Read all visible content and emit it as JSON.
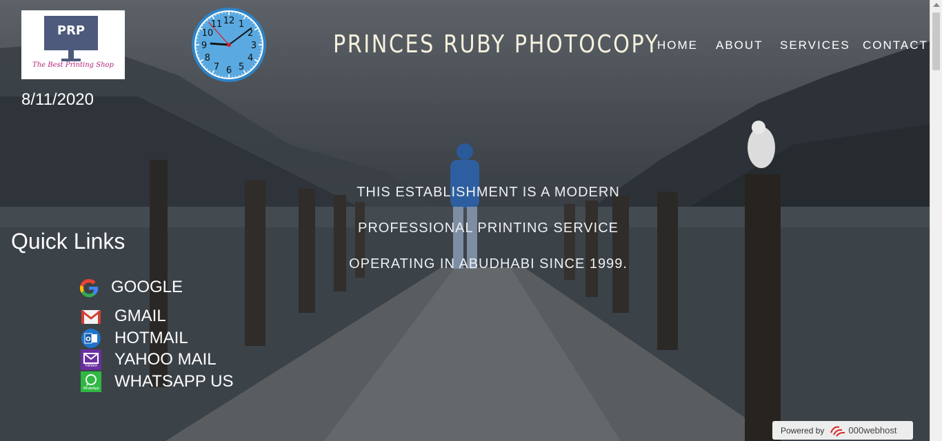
{
  "logo": {
    "text": "PRP",
    "tagline": "The Best Printing Shop"
  },
  "date": "8/11/2020",
  "clock": {
    "hour": 9,
    "minute": 8,
    "second": 53,
    "numerals": [
      "12",
      "1",
      "2",
      "3",
      "4",
      "5",
      "6",
      "7",
      "8",
      "9",
      "10",
      "11"
    ]
  },
  "site_title": "PRINCES RUBY PHOTOCOPY",
  "nav": {
    "items": [
      {
        "label": "HOME"
      },
      {
        "label": "ABOUT"
      },
      {
        "label": "SERVICES"
      },
      {
        "label": "CONTACT"
      }
    ]
  },
  "intro": {
    "lines": [
      "THIS ESTABLISHMENT IS A MODERN",
      "PROFESSIONAL PRINTING SERVICE",
      "OPERATING IN ABUDHABI SINCE 1999."
    ]
  },
  "quick_links": {
    "title": "Quick Links",
    "items": [
      {
        "label": "GOOGLE",
        "icon": "google-icon"
      },
      {
        "label": "GMAIL",
        "icon": "gmail-icon"
      },
      {
        "label": "HOTMAIL",
        "icon": "outlook-icon"
      },
      {
        "label": "YAHOO MAIL",
        "icon": "yahoo-mail-icon",
        "icon_text": "Yahoo!"
      },
      {
        "label": "WHATSAPP US",
        "icon": "whatsapp-icon",
        "icon_text": "WhatsApp"
      }
    ]
  },
  "powered": {
    "prefix": "Powered by",
    "brand": "000webhost"
  },
  "colors": {
    "title": "#f6f1dc",
    "clock_face": "#5aa9e0",
    "second_hand": "#d42020"
  }
}
